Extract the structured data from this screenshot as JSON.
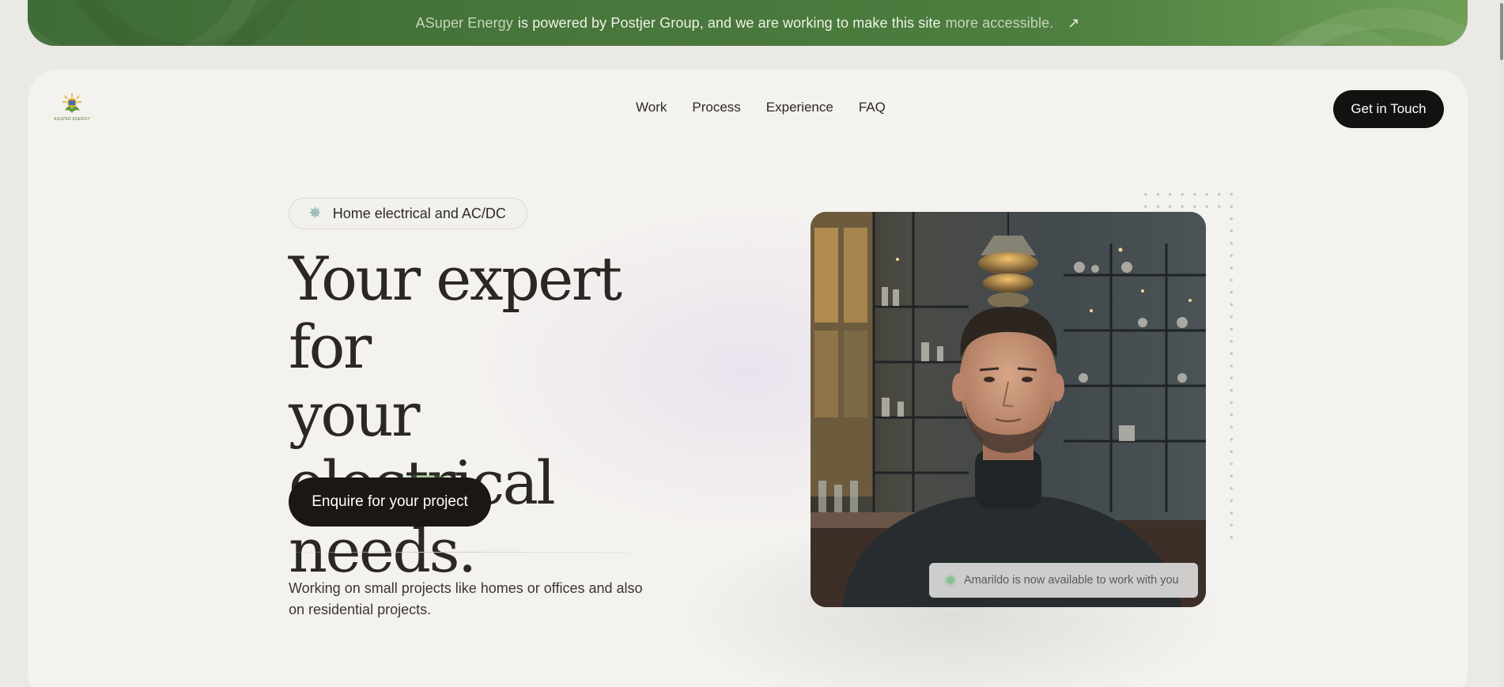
{
  "banner": {
    "brand": "ASuper Energy",
    "text": "is powered by Postjer Group, and we are working to make this site",
    "link": "more accessible.",
    "arrow_icon": "arrow-up-right-icon"
  },
  "header": {
    "logo_text": "ASUPER ENERGY",
    "nav": [
      "Work",
      "Process",
      "Experience",
      "FAQ"
    ],
    "cta_label": "Get in Touch"
  },
  "hero": {
    "pill_icon": "sparkle-icon",
    "pill_text": "Home electrical and AC/DC",
    "title_lines": [
      "Your expert for",
      "your electrical",
      "needs."
    ],
    "button_label": "Enquire for your project",
    "description": "Working on small projects like homes or offices and also on residential projects."
  },
  "photo": {
    "availability_text": "Amarildo is now available to work with you",
    "status_color": "#86c08f"
  },
  "colors": {
    "banner_green": "#48763b",
    "card_bg": "#f4f2ef",
    "button_dark": "#141210"
  }
}
